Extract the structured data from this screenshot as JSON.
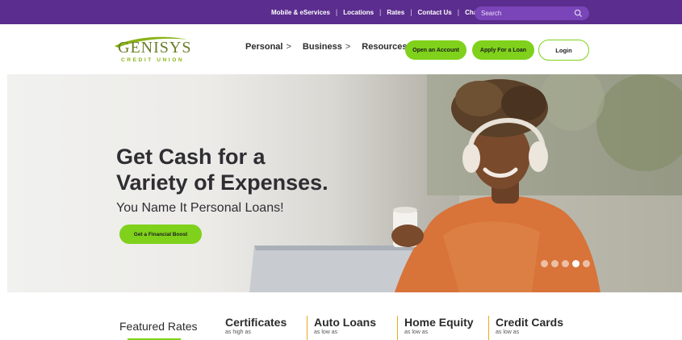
{
  "topbar": {
    "links": [
      "Mobile & eServices",
      "Locations",
      "Rates",
      "Contact Us",
      "Chat"
    ],
    "search_placeholder": "Search",
    "search_icon": "search-icon"
  },
  "logo": {
    "main": "GENISYS",
    "sub": "CREDIT UNION"
  },
  "nav": {
    "personal": "Personal",
    "business": "Business",
    "resources": "Resources",
    "chevron": ">"
  },
  "buttons": {
    "open_account": "Open an Account",
    "apply_loan": "Apply For a Loan",
    "login": "Login"
  },
  "hero": {
    "title_line1": "Get Cash for a",
    "title_line2": "Variety of Expenses.",
    "subtitle": "You Name It Personal Loans!",
    "cta": "Get a Financial Boost",
    "slide_count": 5,
    "active_slide": 4
  },
  "rates": {
    "title": "Featured Rates",
    "items": [
      {
        "name": "Certificates",
        "note": "as high as"
      },
      {
        "name": "Auto Loans",
        "note": "as low as"
      },
      {
        "name": "Home Equity",
        "note": "as low as"
      },
      {
        "name": "Credit Cards",
        "note": "as low as"
      }
    ]
  },
  "colors": {
    "topbar": "#5b2d8e",
    "accent_green": "#7fd11b",
    "divider_orange": "#f0a81c"
  }
}
